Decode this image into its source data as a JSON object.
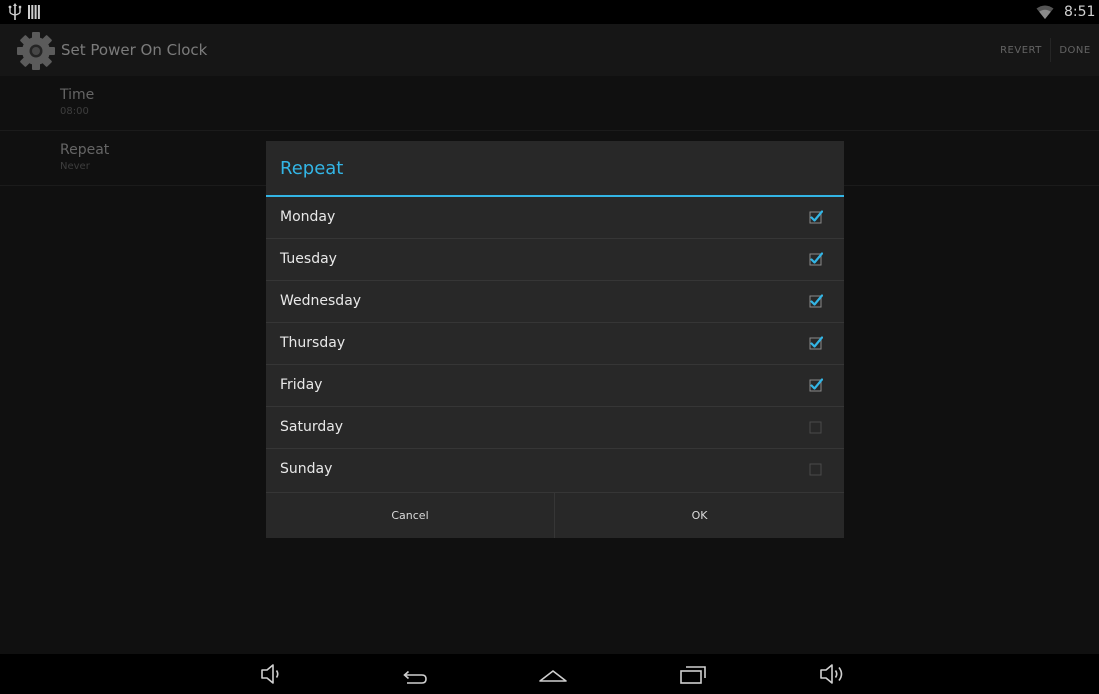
{
  "status_bar": {
    "time": "8:51",
    "icons": [
      "usb-icon",
      "sd-card-icon",
      "wifi-icon"
    ]
  },
  "action_bar": {
    "title": "Set Power On Clock",
    "icon": "gear-icon",
    "revert_label": "REVERT",
    "done_label": "DONE"
  },
  "preferences": [
    {
      "title": "Time",
      "summary": "08:00"
    },
    {
      "title": "Repeat",
      "summary": "Never"
    }
  ],
  "dialog": {
    "title": "Repeat",
    "days": [
      {
        "label": "Monday",
        "checked": true
      },
      {
        "label": "Tuesday",
        "checked": true
      },
      {
        "label": "Wednesday",
        "checked": true
      },
      {
        "label": "Thursday",
        "checked": true
      },
      {
        "label": "Friday",
        "checked": true
      },
      {
        "label": "Saturday",
        "checked": false
      },
      {
        "label": "Sunday",
        "checked": false
      }
    ],
    "cancel_label": "Cancel",
    "ok_label": "OK"
  },
  "nav_bar": {
    "icons": [
      "volume-down-icon",
      "back-icon",
      "home-icon",
      "recent-apps-icon",
      "volume-up-icon"
    ]
  },
  "colors": {
    "accent": "#33b5e5",
    "dialog_background": "#282828",
    "app_background": "#191919"
  }
}
